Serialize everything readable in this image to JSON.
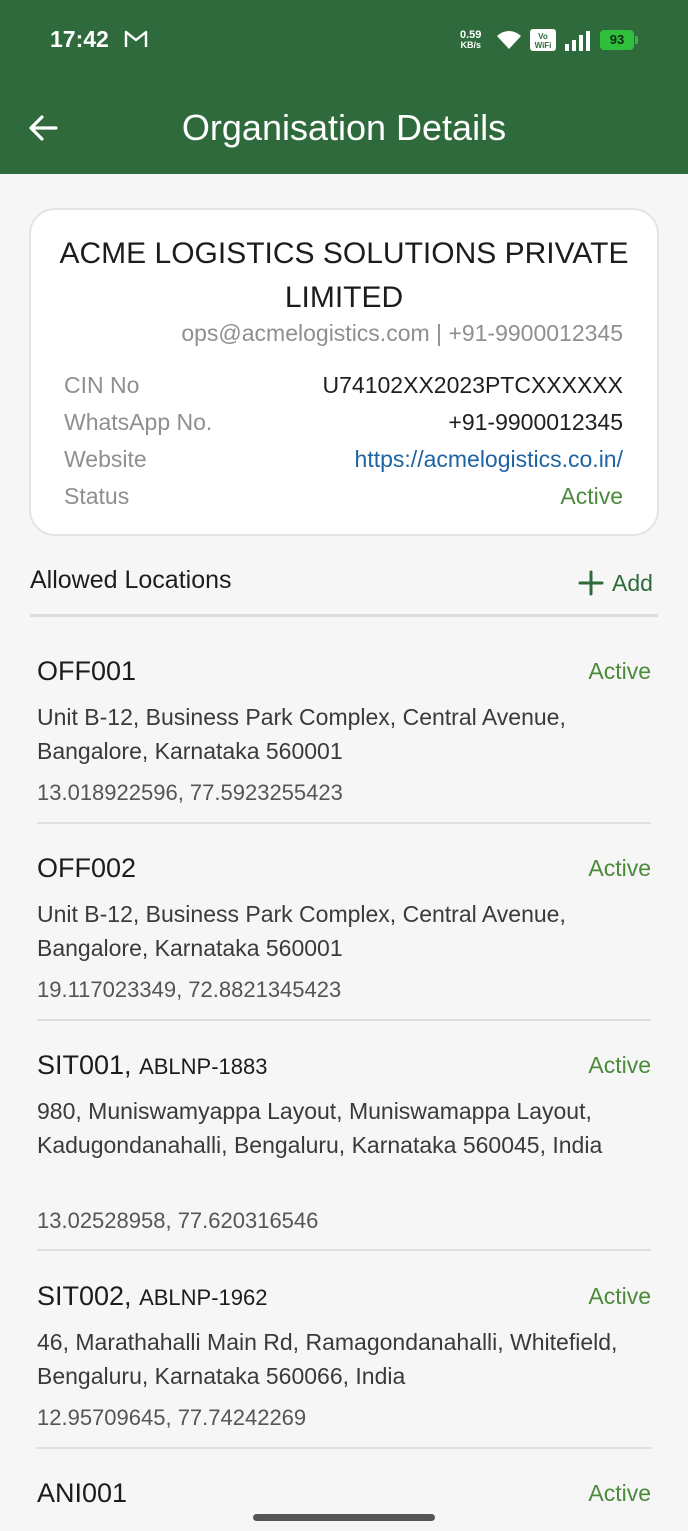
{
  "status_bar": {
    "time": "17:42",
    "net_speed_value": "0.59",
    "net_speed_unit": "KB/s",
    "vowifi_top": "Vo",
    "vowifi_bottom": "WiFi",
    "battery": "93"
  },
  "header": {
    "title": "Organisation Details"
  },
  "org": {
    "name": "ACME LOGISTICS SOLUTIONS PRIVATE LIMITED",
    "contact": "ops@acmelogistics.com | +91-9900012345",
    "details": [
      {
        "label": "CIN No",
        "value": "U74102XX2023PTCXXXXXX"
      },
      {
        "label": "WhatsApp No.",
        "value": "+91-9900012345"
      },
      {
        "label": "Website",
        "value": "https://acmelogistics.co.in/"
      },
      {
        "label": "Status",
        "value": "Active"
      }
    ]
  },
  "locations_section": {
    "title": "Allowed Locations",
    "add_label": "Add"
  },
  "locations": [
    {
      "code": "OFF001",
      "sub": "",
      "status": "Active",
      "address": "Unit B-12, Business Park Complex, Central Avenue, Bangalore, Karnataka 560001",
      "coords": "13.018922596, 77.5923255423"
    },
    {
      "code": "OFF002",
      "sub": "",
      "status": "Active",
      "address": "Unit B-12, Business Park Complex, Central Avenue, Bangalore, Karnataka 560001",
      "coords": "19.117023349, 72.8821345423"
    },
    {
      "code": "SIT001,",
      "sub": "ABLNP-1883",
      "status": "Active",
      "address": "980, Muniswamyappa Layout, Muniswamappa Layout, Kadugondanahalli, Bengaluru, Karnataka 560045, India",
      "coords": "13.02528958, 77.620316546"
    },
    {
      "code": "SIT002,",
      "sub": "ABLNP-1962",
      "status": "Active",
      "address": "46, Marathahalli Main Rd, Ramagondanahalli, Whitefield, Bengaluru, Karnataka 560066, India",
      "coords": "12.95709645, 77.74242269"
    },
    {
      "code": "ANI001",
      "sub": "",
      "status": "Active",
      "address": "",
      "coords": ""
    }
  ]
}
